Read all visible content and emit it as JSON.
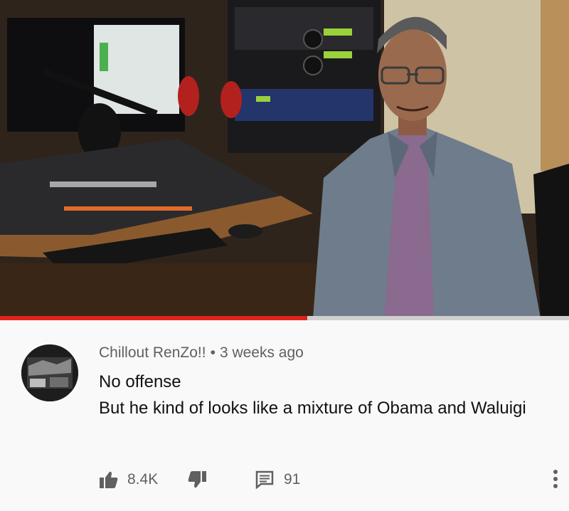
{
  "video": {
    "progress_fraction": 0.54,
    "progress_color": "#e0241b"
  },
  "comment": {
    "author": "Chillout RenZo!!",
    "separator": "•",
    "time": "3 weeks ago",
    "lines": [
      "No offense",
      "But he kind of looks like a mixture of Obama and Waluigi"
    ]
  },
  "actions": {
    "like_count": "8.4K",
    "reply_count": "91",
    "icons": [
      "thumbs-up-icon",
      "thumbs-down-icon",
      "comment-icon",
      "more-vertical-icon"
    ]
  }
}
